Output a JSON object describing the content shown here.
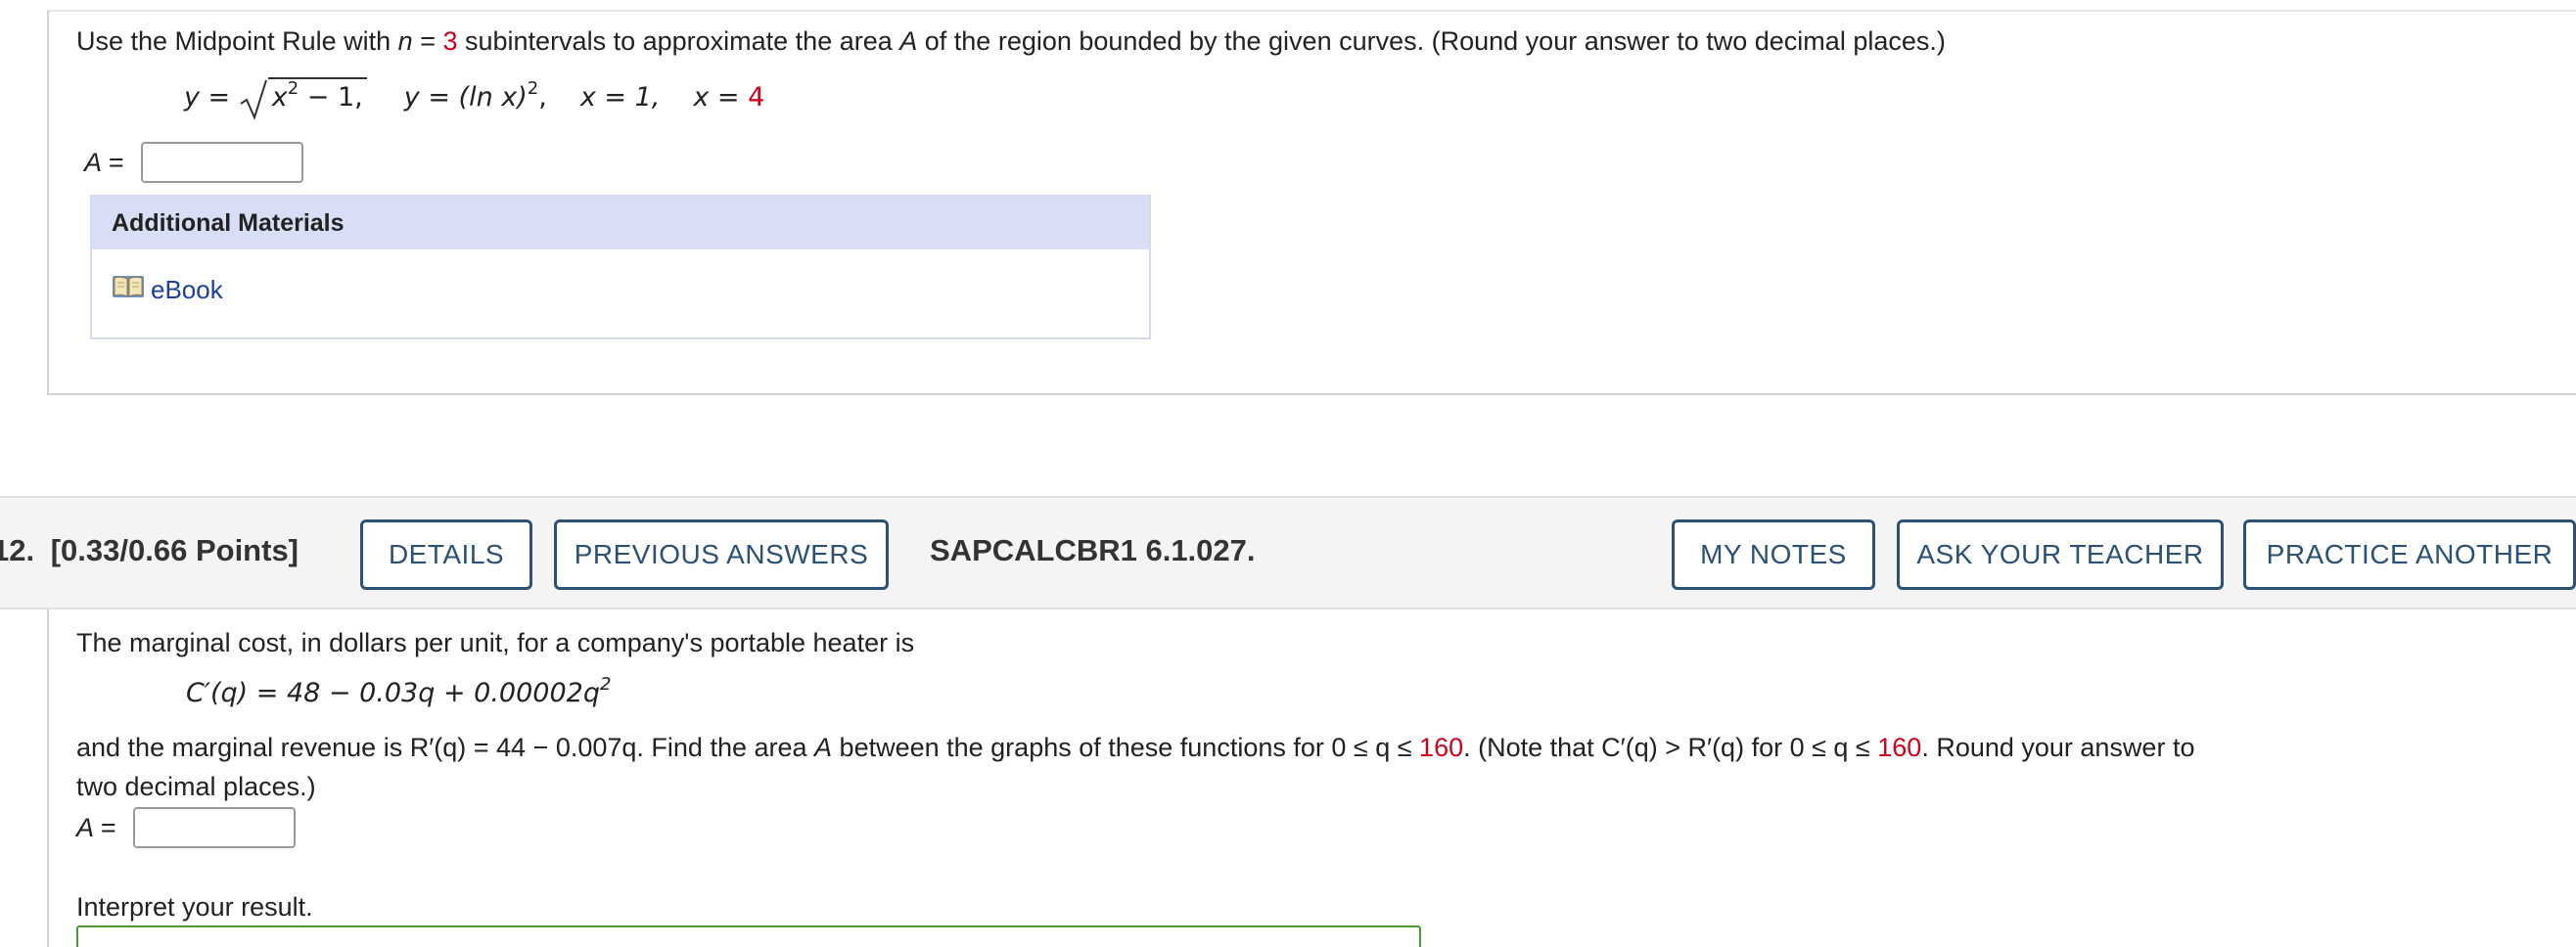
{
  "question1": {
    "prompt": {
      "part1": "Use the Midpoint Rule with ",
      "n_var": "n",
      "eq": " = ",
      "n_value": "3",
      "part2": " subintervals to approximate the area ",
      "a_var": "A",
      "part3": " of the region bounded by the given curves. (Round your answer to two decimal places.)"
    },
    "equations": {
      "y1_lhs": "y = ",
      "sqrt_body": "x",
      "sqrt_exp": "2",
      "sqrt_tail": " − 1,",
      "y2": "y = (ln x)",
      "y2_exp": "2",
      "y2_tail": ",",
      "x1": "x = 1,",
      "x2_lhs": "x = ",
      "x2_val": "4"
    },
    "answer_label": "A =",
    "answer_value": "",
    "additional_materials": {
      "header": "Additional Materials",
      "ebook_label": "eBook"
    }
  },
  "question12": {
    "number": "12.",
    "points": "[0.33/0.66 Points]",
    "buttons": {
      "details": "DETAILS",
      "previous_answers": "PREVIOUS ANSWERS",
      "my_notes": "MY NOTES",
      "ask_teacher": "ASK YOUR TEACHER",
      "practice_another": "PRACTICE ANOTHER"
    },
    "source_code": "SAPCALCBR1 6.1.027.",
    "intro": "The marginal cost, in dollars per unit, for a company's portable heater is",
    "cost_fn": "C′(q) = 48 − 0.03q + 0.00002q",
    "cost_exp": "2",
    "line3": {
      "a": "and the marginal revenue is  R′(q) = 44 − 0.007q.  Find the area ",
      "a_var": "A",
      "b": " between the graphs of these functions for  0 ≤ q ≤ ",
      "upper1": "160",
      "c": ".  (Note that  C′(q) > R′(q)  for  0 ≤ q ≤ ",
      "upper2": "160",
      "d": ".  Round your answer to"
    },
    "line4": "two decimal places.)",
    "answer_label": "A =",
    "answer_value": "",
    "interpret_label": "Interpret your result."
  }
}
